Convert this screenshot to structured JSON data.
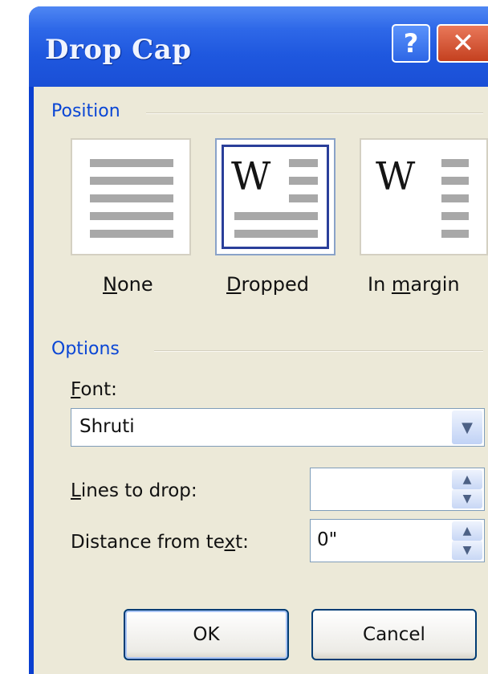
{
  "dialog": {
    "title": "Drop Cap",
    "help_symbol": "?",
    "close_symbol": "✕"
  },
  "position": {
    "group_label": "Position",
    "options": [
      {
        "key": "none",
        "pre": "",
        "mnemonic": "N",
        "post": "one",
        "icon": "drop-cap-none-icon",
        "selected": false
      },
      {
        "key": "dropped",
        "pre": "",
        "mnemonic": "D",
        "post": "ropped",
        "icon": "drop-cap-dropped-icon",
        "selected": true,
        "glyph": "W"
      },
      {
        "key": "in_margin",
        "pre": "In ",
        "mnemonic": "m",
        "post": "argin",
        "icon": "drop-cap-in-margin-icon",
        "selected": false,
        "glyph": "W"
      }
    ]
  },
  "options": {
    "group_label": "Options",
    "font": {
      "pre": "",
      "mnemonic": "F",
      "post": "ont:",
      "value": "Shruti",
      "dropdown_icon": "chevron-down-icon"
    },
    "lines_to_drop": {
      "pre": "",
      "mnemonic": "L",
      "post": "ines to drop:",
      "value": ""
    },
    "distance_from_text": {
      "pre": "Distance from te",
      "mnemonic": "x",
      "post": "t:",
      "value": "0\""
    }
  },
  "buttons": {
    "ok": "OK",
    "cancel": "Cancel"
  },
  "colors": {
    "title_bar": "#245edb",
    "client_bg": "#ece9d8",
    "group_label": "#0a46d5",
    "close_button": "#d5532f"
  }
}
